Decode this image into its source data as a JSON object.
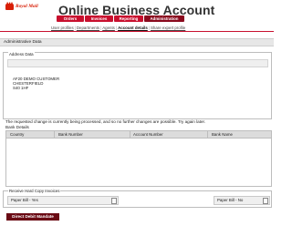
{
  "brand": {
    "logo_text": "Royal Mail",
    "app_title": "Online Business Account"
  },
  "tabs": [
    {
      "label": "Orders"
    },
    {
      "label": "Invoices"
    },
    {
      "label": "Reporting"
    },
    {
      "label": "Administration",
      "active": true
    }
  ],
  "subnav": [
    {
      "label": "User profiles"
    },
    {
      "label": "Departments"
    },
    {
      "label": "Agents"
    },
    {
      "label": "Account details",
      "active": true
    },
    {
      "label": "Share expert profile"
    }
  ],
  "section_title": "Administrative Data",
  "address": {
    "legend": "Address Data",
    "lines": [
      "AF20 DEMO CUSTOMER",
      "CHESTERFIELD",
      "S40 1HF"
    ]
  },
  "notice": "The requested change is currently being processed, and so no further changes are possible. Try again later.",
  "bank": {
    "title": "Bank Details",
    "columns": [
      "Country",
      "Bank Number",
      "Account Number",
      "Bank Name"
    ]
  },
  "invoices": {
    "legend": "Receive Hard Copy Invoices",
    "paper_bill_left": "Paper Bill - Yes",
    "paper_bill_right": "Paper Bill - No"
  },
  "direct_debit_button": "Direct Debit Mandate",
  "colors": {
    "accent": "#c8102e",
    "accent_dark": "#8a0a1e",
    "button": "#6a0a14",
    "logo": "#d81e05"
  }
}
